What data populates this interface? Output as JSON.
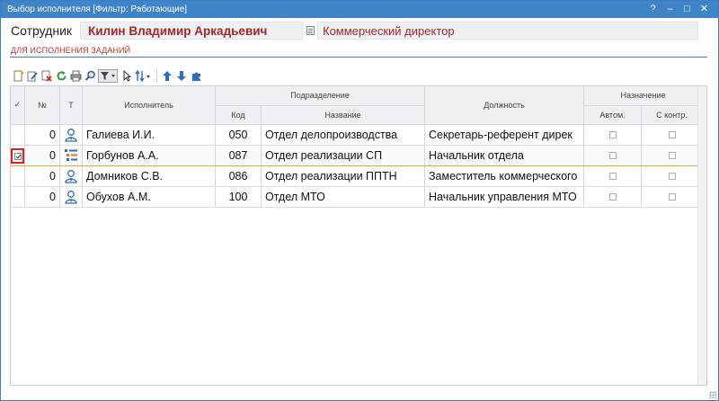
{
  "window": {
    "title": "Выбор исполнителя [Фильтр: Работающие]",
    "controls": [
      "?",
      "–",
      "□",
      "✕"
    ]
  },
  "employee": {
    "label": "Сотрудник",
    "name": "Килин Владимир Аркадьевич",
    "position": "Коммерческий директор"
  },
  "tab": {
    "label": "ДЛЯ ИСПОЛНЕНИЯ ЗАДАНИЙ"
  },
  "toolbar": {
    "icons": [
      "new-icon",
      "edit-icon",
      "delete-icon",
      "refresh-icon",
      "print-icon",
      "search-icon",
      "filter-icon",
      "cursor-icon",
      "sort-icon",
      "arrow-up-icon",
      "arrow-down-icon",
      "puzzle-icon"
    ]
  },
  "grid": {
    "headers": {
      "check": "✓",
      "num": "№",
      "type": "Т",
      "executor": "Исполнитель",
      "department": "Подразделение",
      "dept_code": "Код",
      "dept_name": "Название",
      "position": "Должность",
      "assignment": "Назначение",
      "auto": "Автом.",
      "with_control": "С контр."
    },
    "rows": [
      {
        "num": "0",
        "type_icon": "user-icon",
        "executor": "Галиева И.И.",
        "code": "050",
        "dept": "Отдел делопроизводства",
        "position": "Секретарь-референт дирек",
        "selected": false
      },
      {
        "num": "0",
        "type_icon": "group-list-icon",
        "executor": "Горбунов А.А.",
        "code": "087",
        "dept": "Отдел реализации СП",
        "position": "Начальник отдела",
        "selected": true
      },
      {
        "num": "0",
        "type_icon": "user-icon",
        "executor": "Домников С.В.",
        "code": "086",
        "dept": "Отдел реализации ППТН",
        "position": "Заместитель коммерческого",
        "selected": false
      },
      {
        "num": "0",
        "type_icon": "user-icon",
        "executor": "Обухов А.М.",
        "code": "100",
        "dept": "Отдел МТО",
        "position": "Начальник управления МТО",
        "selected": false
      }
    ]
  },
  "colors": {
    "titlebar": "#3f83c9",
    "accent_text": "#a4272a",
    "selection_border": "#e0201e",
    "selected_row_line": "#e3a83a"
  }
}
